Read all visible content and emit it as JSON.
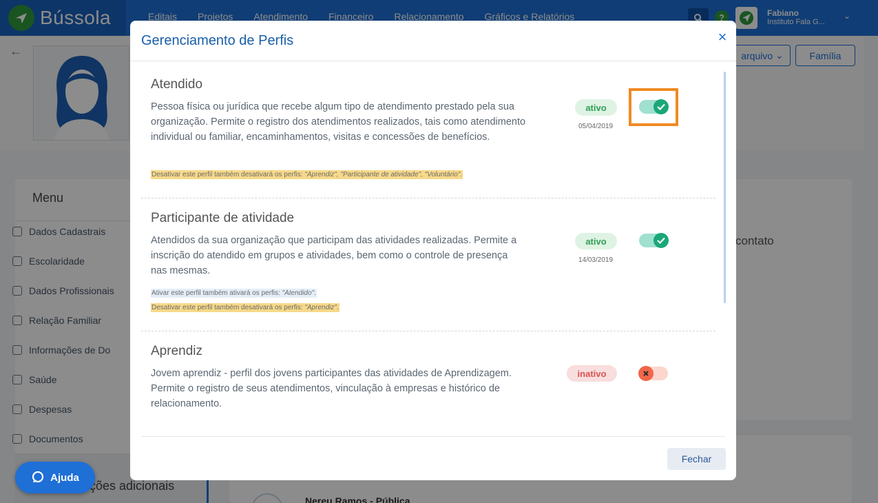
{
  "app": {
    "logo": "Bússola",
    "nav": [
      "Editais",
      "Projetos",
      "Atendimento",
      "Financeiro",
      "Relacionamento",
      "Gráficos e Relatórios"
    ],
    "user": {
      "name": "Fabiano",
      "org": "Instituto Fala G..."
    }
  },
  "header_buttons": {
    "arquivo": "arquivo",
    "familia": "Família"
  },
  "menu": {
    "title": "Menu",
    "items": [
      "Dados Cadastrais",
      "Escolaridade",
      "Dados Profissionais",
      "Relação Familiar",
      "Informações de Do",
      "Saúde",
      "Despesas",
      "Documentos"
    ],
    "more": "ções adicionais"
  },
  "background": {
    "contato": "contato",
    "nereu": "Nereu Ramos - Pública"
  },
  "help": {
    "label": "Ajuda"
  },
  "modal": {
    "title": "Gerenciamento de Perfis",
    "close": "×",
    "close_button": "Fechar",
    "profiles": [
      {
        "title": "Atendido",
        "description": "Pessoa física ou jurídica que recebe algum tipo de atendimento prestado pela sua organização. Permite o registro dos atendimentos realizados, tais como atendimento individual ou familiar, encaminhamentos, visitas e concessões de benefícios.",
        "status": "ativo",
        "date": "05/04/2019",
        "active": true,
        "note_warn_prefix": "Desativar este perfil também desativará os perfis: ",
        "note_warn_list": "\"Aprendiz\", \"Participante de atividade\", \"Voluntário\"",
        "note_warn_end": "."
      },
      {
        "title": "Participante de atividade",
        "description": "Atendidos da sua organização que participam das atividades realizadas. Permite a inscrição do atendido em grupos e atividades, bem como o controle de presença nas mesmas.",
        "status": "ativo",
        "date": "14/03/2019",
        "active": true,
        "note_info_prefix": "Ativar este perfil também ativará os perfis: ",
        "note_info_list": "\"Atendido\"",
        "note_info_end": ".",
        "note_warn_prefix": "Desativar este perfil também desativará os perfis: ",
        "note_warn_list": "\"Aprendiz\"",
        "note_warn_end": "."
      },
      {
        "title": "Aprendiz",
        "description": "Jovem aprendiz - perfil dos jovens participantes das atividades de Aprendizagem. Permite o registro de seus atendimentos, vinculação à empresas e histórico de relacionamento.",
        "status": "inativo",
        "active": false
      }
    ]
  },
  "colors": {
    "primary": "#1e6fd6",
    "active_green": "#1aa778",
    "inactive_red": "#f0674a",
    "highlight_orange": "#f08a24"
  }
}
